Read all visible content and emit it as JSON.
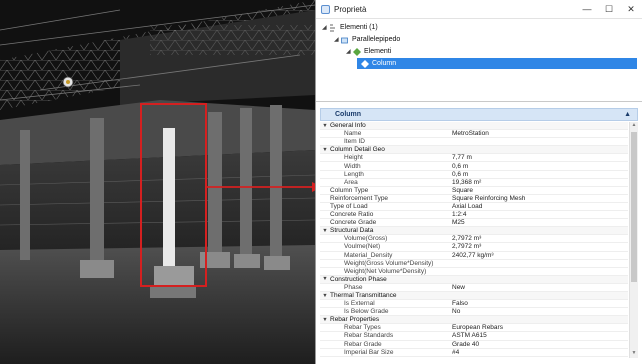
{
  "window": {
    "title": "Proprietà",
    "minimize": "—",
    "maximize": "☐",
    "close": "✕"
  },
  "tree": [
    {
      "label": "Elementi (1)",
      "expanded": true
    },
    {
      "label": "Parallelepipedo",
      "expanded": true
    },
    {
      "label": "Elementi",
      "expanded": true
    },
    {
      "label": "Column",
      "selected": true
    }
  ],
  "section": {
    "title": "Column",
    "collapse_icon": "▲"
  },
  "properties": [
    {
      "type": "cat",
      "label": "General Info"
    },
    {
      "type": "lvl1",
      "name": "Name",
      "value": "MetroStation"
    },
    {
      "type": "lvl1",
      "name": "Item ID",
      "value": ""
    },
    {
      "type": "cat",
      "label": "Column Detail Geo"
    },
    {
      "type": "lvl1",
      "name": "Height",
      "value": "7,77 m"
    },
    {
      "type": "lvl1",
      "name": "Width",
      "value": "0,6 m"
    },
    {
      "type": "lvl1",
      "name": "Length",
      "value": "0,6 m"
    },
    {
      "type": "lvl1",
      "name": "Area",
      "value": "19,368 m²"
    },
    {
      "type": "lvl0",
      "name": "Column Type",
      "value": "Square"
    },
    {
      "type": "lvl0",
      "name": "Reinforcement Type",
      "value": "Square Reinforcing Mesh"
    },
    {
      "type": "lvl0",
      "name": "Type of Load",
      "value": "Axial Load"
    },
    {
      "type": "lvl0",
      "name": "Concrete Ratio",
      "value": "1:2:4"
    },
    {
      "type": "lvl0",
      "name": "Concrete Grade",
      "value": "M25"
    },
    {
      "type": "cat",
      "label": "Structural Data"
    },
    {
      "type": "lvl1",
      "name": "Volume(Gross)",
      "value": "2,7972 m³"
    },
    {
      "type": "lvl1",
      "name": "Voulme(Net)",
      "value": "2,7972 m³"
    },
    {
      "type": "lvl1",
      "name": "Material_Density",
      "value": "2402,77 kg/m³"
    },
    {
      "type": "lvl1",
      "name": "Weight(Gross Volume*Density)",
      "value": ""
    },
    {
      "type": "lvl1",
      "name": "Weight(Net Volume*Density)",
      "value": ""
    },
    {
      "type": "cat",
      "label": "Construction Phase"
    },
    {
      "type": "lvl1",
      "name": "Phase",
      "value": "New"
    },
    {
      "type": "cat",
      "label": "Thermal Transmittance"
    },
    {
      "type": "lvl1",
      "name": "Is External",
      "value": "Falso"
    },
    {
      "type": "lvl1",
      "name": "Is Below Grade",
      "value": "No"
    },
    {
      "type": "cat",
      "label": "Rebar Properties"
    },
    {
      "type": "lvl1",
      "name": "Rebar Types",
      "value": "European Rebars"
    },
    {
      "type": "lvl1",
      "name": "Rebar Standards",
      "value": "ASTM A615"
    },
    {
      "type": "lvl1",
      "name": "Rebar Grade",
      "value": "Grade 40"
    },
    {
      "type": "lvl1",
      "name": "Imperial Bar Size",
      "value": "#4"
    }
  ],
  "colors": {
    "highlight_box": "#d42020",
    "selection": "#2f86e6",
    "section_header": "#d6e5f6"
  },
  "icons": {
    "tree_root": "elements-icon",
    "tree_shape": "cube-icon",
    "tree_elements": "elements-icon",
    "tree_column": "column-icon"
  }
}
